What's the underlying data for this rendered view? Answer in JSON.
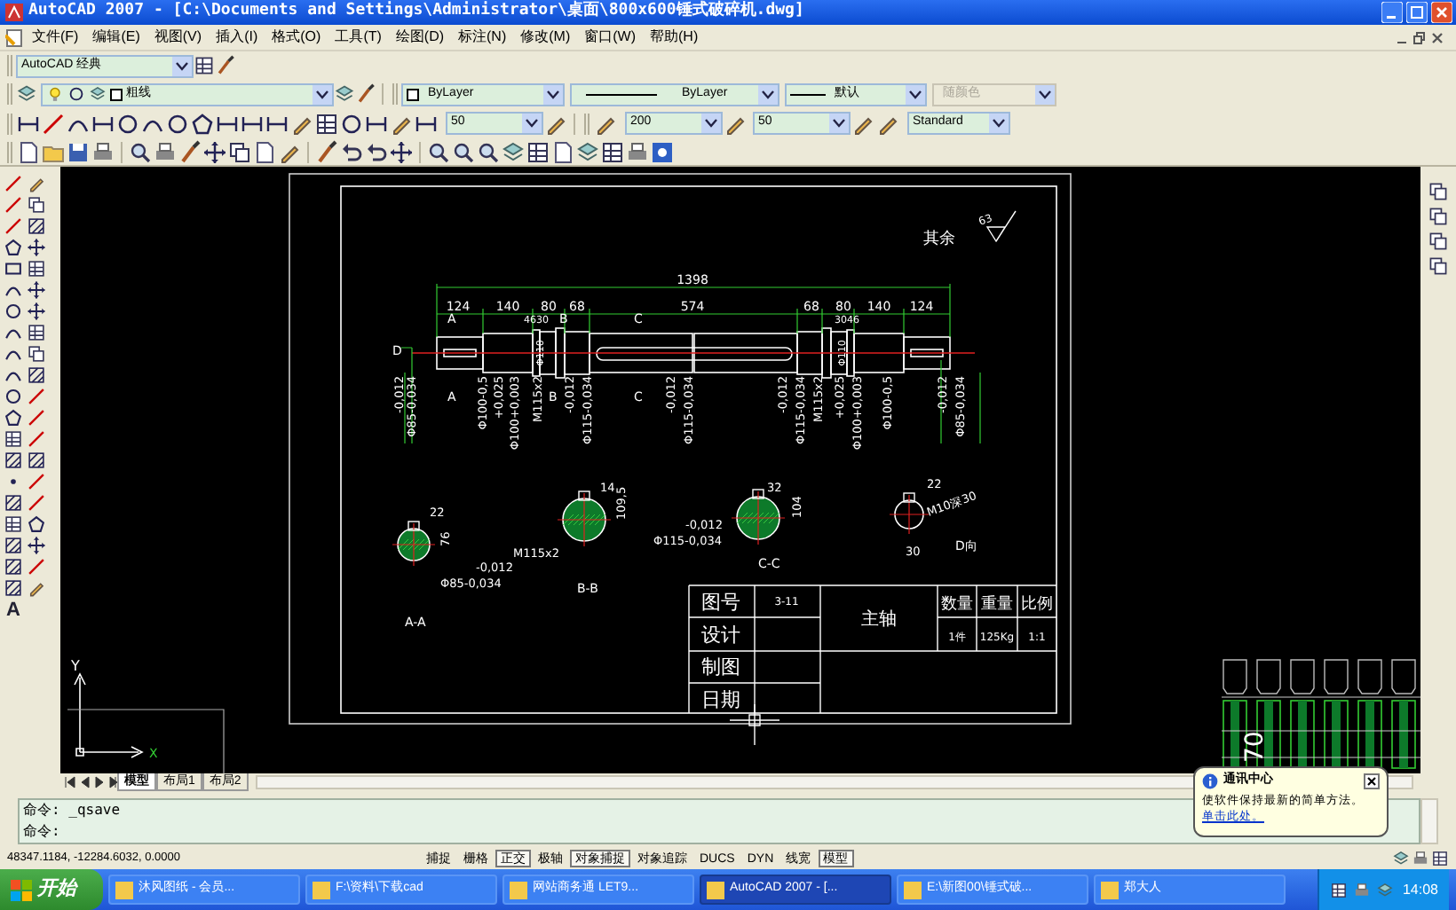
{
  "window": {
    "title": "AutoCAD 2007 - [C:\\Documents and Settings\\Administrator\\桌面\\800x600锤式破碎机.dwg]"
  },
  "menu": [
    "文件(F)",
    "编辑(E)",
    "视图(V)",
    "插入(I)",
    "格式(O)",
    "工具(T)",
    "绘图(D)",
    "标注(N)",
    "修改(M)",
    "窗口(W)",
    "帮助(H)"
  ],
  "workspace": {
    "value": "AutoCAD 经典"
  },
  "layer": {
    "value": "粗线"
  },
  "properties": [
    {
      "kind": "color",
      "value": "ByLayer",
      "disabled": false
    },
    {
      "kind": "linetype",
      "value": "ByLayer",
      "disabled": false
    },
    {
      "kind": "lineweight",
      "value": "默认",
      "disabled": false
    },
    {
      "kind": "plotstyle",
      "value": "随颜色",
      "disabled": true
    }
  ],
  "styles": [
    {
      "value": "50"
    },
    {
      "value": "200"
    },
    {
      "value": "50"
    },
    {
      "value": "Standard"
    }
  ],
  "left_toolbar": {
    "text_tool": "A"
  },
  "drawing": {
    "note": "其余",
    "roughness_value": "63",
    "overall_length": "1398",
    "segment_lengths": [
      "124",
      "140",
      "80",
      "68",
      "574",
      "68",
      "80",
      "140",
      "124"
    ],
    "diameter_labels": [
      "-0,012",
      "Φ85-0,034",
      "Φ100-0,5",
      "+0,025",
      "Φ100+0,003",
      "M115x2",
      "-0,012",
      "Φ115-0,034",
      "-0,012",
      "Φ115-0,034",
      "-0,012",
      "Φ115-0,034",
      "M115x2",
      "+0,025",
      "Φ100+0,003",
      "Φ100-0,5",
      "-0,012",
      "Φ85-0,034"
    ],
    "inner_labels": [
      "Φ110",
      "46",
      "30",
      "Φ110",
      "30",
      "46"
    ],
    "section_marks": [
      "D",
      "A",
      "A",
      "B",
      "B",
      "C",
      "C"
    ],
    "sections": [
      {
        "title": "A-A",
        "texts": [
          "22",
          "76",
          "-0,012",
          "Φ85-0,034"
        ]
      },
      {
        "title": "B-B",
        "texts": [
          "14",
          "109,5",
          "M115x2"
        ]
      },
      {
        "title": "C-C",
        "texts": [
          "32",
          "104",
          "-0,012",
          "Φ115-0,034"
        ]
      },
      {
        "title": "D向",
        "texts": [
          "22",
          "M10深30",
          "30"
        ]
      }
    ],
    "title_block": {
      "rows": [
        {
          "label": "图号",
          "value": "3-11"
        },
        {
          "label": "设计"
        },
        {
          "label": "制图"
        },
        {
          "label": "日期"
        }
      ],
      "part_name": "主轴",
      "headers": [
        "数量",
        "重量",
        "比例"
      ],
      "values": [
        "1件",
        "125Kg",
        "1:1"
      ]
    },
    "neighbor_dimension": "70",
    "ucs": {
      "y": "Y",
      "x": "X"
    }
  },
  "tabs": [
    {
      "label": "模型",
      "selected": true
    },
    {
      "label": "布局1",
      "selected": false
    },
    {
      "label": "布局2",
      "selected": false
    }
  ],
  "command": {
    "history": "命令: _qsave",
    "prompt": "命令:"
  },
  "status_bar": {
    "coordinates": "48347.1184, -12284.6032, 0.0000",
    "toggles": [
      {
        "label": "捕捉",
        "on": false
      },
      {
        "label": "栅格",
        "on": false
      },
      {
        "label": "正交",
        "on": true
      },
      {
        "label": "极轴",
        "on": false
      },
      {
        "label": "对象捕捉",
        "on": true
      },
      {
        "label": "对象追踪",
        "on": false
      },
      {
        "label": "DUCS",
        "on": false
      },
      {
        "label": "DYN",
        "on": false
      },
      {
        "label": "线宽",
        "on": false
      },
      {
        "label": "模型",
        "on": true
      }
    ]
  },
  "balloon": {
    "title": "通讯中心",
    "text": "使软件保持最新的简单方法。",
    "link": "单击此处。"
  },
  "taskbar": {
    "start": "开始",
    "tasks": [
      {
        "label": "沐风图纸 - 会员...",
        "selected": false
      },
      {
        "label": "F:\\资料\\下载cad",
        "selected": false
      },
      {
        "label": "网站商务通 LET9...",
        "selected": false
      },
      {
        "label": "AutoCAD 2007 - [...",
        "selected": true
      },
      {
        "label": "E:\\新图00\\锤式破...",
        "selected": false
      },
      {
        "label": "郑大人",
        "selected": false
      }
    ],
    "clock": "14:08"
  }
}
